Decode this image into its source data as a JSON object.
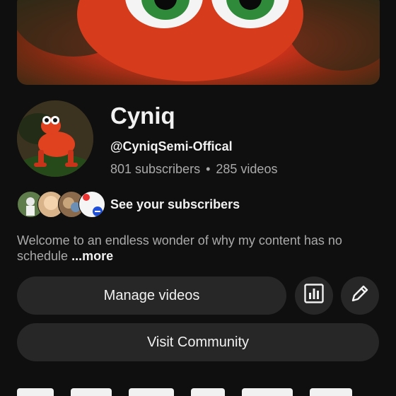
{
  "channel": {
    "name": "Cyniq",
    "handle": "@CyniqSemi-Offical",
    "subscribers": "801 subscribers",
    "separator": "•",
    "videos": "285 videos"
  },
  "subscribers_link": {
    "label": "See your subscribers"
  },
  "description": {
    "text": "Welcome to an endless wonder of why my content has no schedule",
    "more_label": "...more"
  },
  "actions": {
    "manage_videos_label": "Manage videos",
    "analytics_icon": "analytics-icon",
    "edit_icon": "pencil-icon",
    "visit_community_label": "Visit Community"
  },
  "colors": {
    "background": "#0f0f0f",
    "button_bg": "#272727",
    "primary_text": "#f1f1f1",
    "secondary_text": "#aaaaaa"
  }
}
